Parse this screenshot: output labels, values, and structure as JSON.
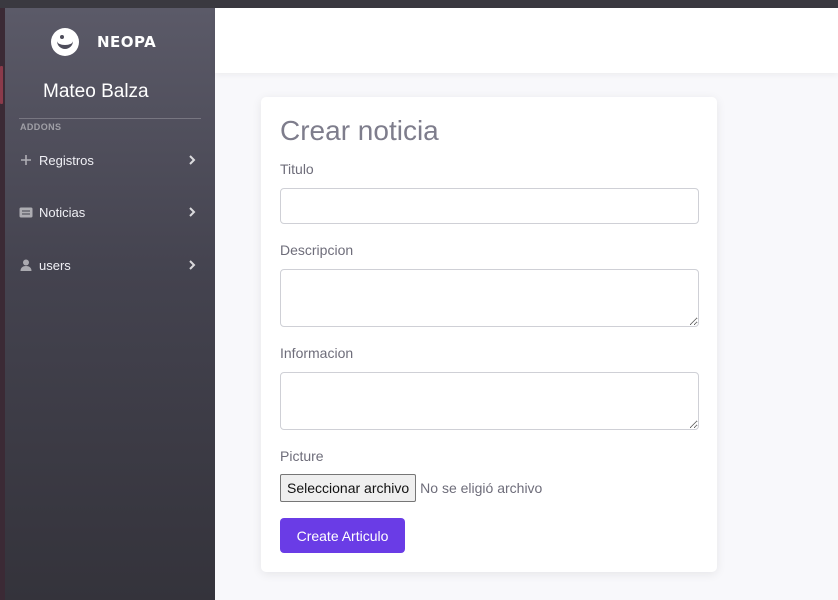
{
  "brand": {
    "name": "NEOPA",
    "logo_icon": "winking-face-icon"
  },
  "user": {
    "name": "Mateo Balza"
  },
  "sidebar": {
    "section_label": "ADDONS",
    "items": [
      {
        "label": "Registros",
        "icon": "plus-icon"
      },
      {
        "label": "Noticias",
        "icon": "newspaper-icon"
      },
      {
        "label": "users",
        "icon": "user-icon"
      }
    ]
  },
  "form": {
    "title": "Crear noticia",
    "fields": {
      "titulo": {
        "label": "Titulo",
        "value": ""
      },
      "descripcion": {
        "label": "Descripcion",
        "value": ""
      },
      "informacion": {
        "label": "Informacion",
        "value": ""
      },
      "picture": {
        "label": "Picture",
        "button_label": "Seleccionar archivo",
        "status": "No se eligió archivo"
      }
    },
    "submit_label": "Create Articulo"
  },
  "colors": {
    "accent": "#6a3ce6",
    "sidebar_top": "#5b5a68",
    "sidebar_bottom": "#34333b",
    "page_background": "#f8f8fb"
  }
}
